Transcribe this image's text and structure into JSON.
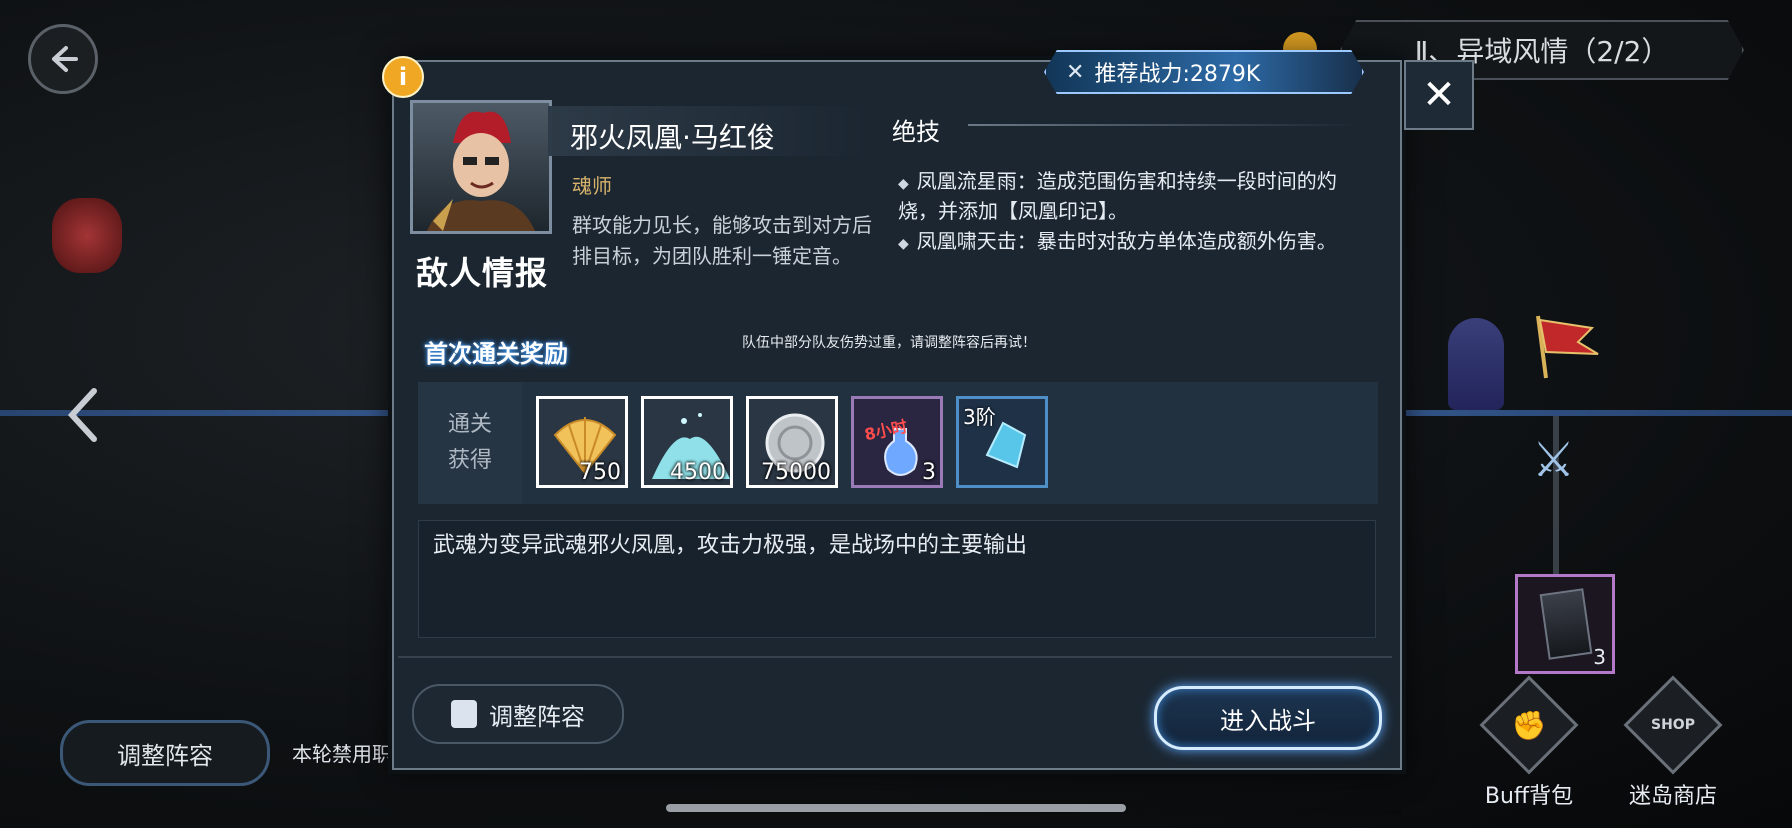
{
  "hud": {
    "chapter_title": "Ⅱ、异域风情（2/2）",
    "adjust_lineup": "调整阵容",
    "ban_text": "本轮禁用职",
    "side_item_count": "3",
    "buff_bag": "Buff背包",
    "shop": "迷岛商店",
    "shop_badge": "SHOP"
  },
  "dialog": {
    "recommended_power": "推荐战力:2879K",
    "enemy": {
      "section_label": "敌人情报",
      "name": "邪火凤凰·马红俊",
      "role": "魂师",
      "description": "群攻能力见长，能够攻击到对方后排目标，为团队胜利一锤定音。"
    },
    "skills": {
      "title": "绝技",
      "items": [
        "凤凰流星雨：造成范围伤害和持续一段时间的灼烧，并添加【凤凰印记】。",
        "凤凰啸天击：暴击时对敌方单体造成额外伤害。"
      ]
    },
    "rewards": {
      "title": "首次通关奖励",
      "warning": "队伍中部分队友伤势过重，请调整阵容后再试！",
      "label_line1": "通关",
      "label_line2": "获得",
      "items": [
        {
          "icon": "shell-icon",
          "qty": "750"
        },
        {
          "icon": "crystal-dust-icon",
          "qty": "4500"
        },
        {
          "icon": "silver-coin-icon",
          "qty": "75000"
        },
        {
          "icon": "potion-icon",
          "qty": "3",
          "tag": "8小时"
        },
        {
          "icon": "blue-gem-icon",
          "tier": "3阶"
        }
      ]
    },
    "note": "武魂为变异武魂邪火凤凰，攻击力极强，是战场中的主要输出",
    "buttons": {
      "adjust": "调整阵容",
      "enter_battle": "进入战斗"
    }
  }
}
